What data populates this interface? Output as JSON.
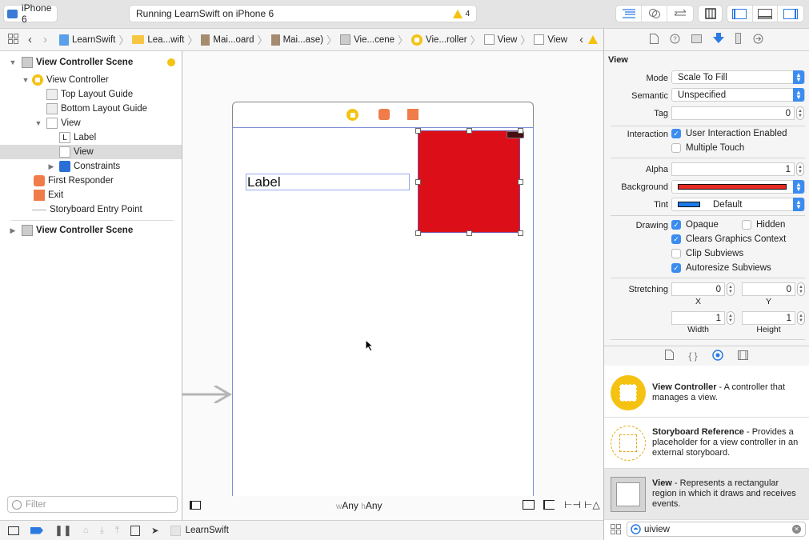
{
  "toolbar": {
    "scheme_device": "iPhone 6",
    "status_text": "Running LearnSwift on iPhone 6",
    "warning_count": "4"
  },
  "jumpbar": {
    "crumbs": [
      "LearnSwift",
      "Lea...wift",
      "Mai...oard",
      "Mai...ase)",
      "Vie...cene",
      "Vie...roller",
      "View",
      "View"
    ]
  },
  "navigator": {
    "items": [
      {
        "label": "View Controller Scene"
      },
      {
        "label": "View Controller"
      },
      {
        "label": "Top Layout Guide"
      },
      {
        "label": "Bottom Layout Guide"
      },
      {
        "label": "View"
      },
      {
        "label": "Label",
        "glyph": "L"
      },
      {
        "label": "View"
      },
      {
        "label": "Constraints"
      },
      {
        "label": "First Responder"
      },
      {
        "label": "Exit"
      },
      {
        "label": "Storyboard Entry Point"
      },
      {
        "label": "View Controller Scene"
      }
    ],
    "filter_placeholder": "Filter"
  },
  "canvas": {
    "label_text": "Label",
    "size_class_w_prefix": "w",
    "size_class_w": "Any",
    "size_class_h_prefix": "h",
    "size_class_h": "Any",
    "red_view_color": "#dc0e18"
  },
  "debugbar": {
    "target": "LearnSwift"
  },
  "inspector": {
    "section_title": "View",
    "mode_label": "Mode",
    "mode_value": "Scale To Fill",
    "semantic_label": "Semantic",
    "semantic_value": "Unspecified",
    "tag_label": "Tag",
    "tag_value": "0",
    "interaction_label": "Interaction",
    "user_interaction": {
      "label": "User Interaction Enabled",
      "checked": true
    },
    "multiple_touch": {
      "label": "Multiple Touch",
      "checked": false
    },
    "alpha_label": "Alpha",
    "alpha_value": "1",
    "background_label": "Background",
    "background_color": "#e52a24",
    "tint_label": "Tint",
    "tint_value": "Default",
    "tint_color": "#1b7ae8",
    "drawing_label": "Drawing",
    "opaque": {
      "label": "Opaque",
      "checked": true
    },
    "hidden": {
      "label": "Hidden",
      "checked": false
    },
    "clears_graphics": {
      "label": "Clears Graphics Context",
      "checked": true
    },
    "clip_subviews": {
      "label": "Clip Subviews",
      "checked": false
    },
    "autoresize": {
      "label": "Autoresize Subviews",
      "checked": true
    },
    "stretching_label": "Stretching",
    "stretch_x": "0",
    "stretch_y": "0",
    "stretch_w": "1",
    "stretch_h": "1",
    "x_label": "X",
    "y_label": "Y",
    "width_label": "Width",
    "height_label": "Height"
  },
  "library": {
    "items": [
      {
        "title": "View Controller",
        "desc": " - A controller that manages a view."
      },
      {
        "title": "Storyboard Reference",
        "desc": " - Provides a placeholder for a view controller in an external storyboard."
      },
      {
        "title": "View",
        "desc": " - Represents a rectangular region in which it draws and receives events."
      }
    ],
    "search_value": "uiview"
  }
}
